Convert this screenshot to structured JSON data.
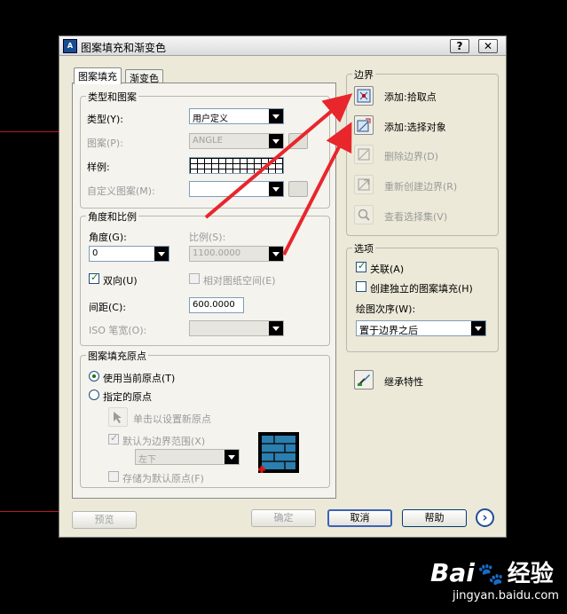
{
  "dialog": {
    "title": "图案填充和渐变色",
    "help_button": "?",
    "close_button": "✕"
  },
  "tabs": [
    {
      "label": "图案填充",
      "selected": true
    },
    {
      "label": "渐变色",
      "selected": false
    }
  ],
  "type_pattern": {
    "title": "类型和图案",
    "type_label": "类型(Y):",
    "type_value": "用户定义",
    "pattern_label": "图案(P):",
    "pattern_value": "ANGLE",
    "sample_label": "样例:",
    "custom_label": "自定义图案(M):",
    "custom_value": ""
  },
  "angle_scale": {
    "title": "角度和比例",
    "angle_label": "角度(G):",
    "angle_value": "0",
    "scale_label": "比例(S):",
    "scale_value": "1100.0000",
    "double_label": "双向(U)",
    "double_checked": true,
    "relative_label": "相对图纸空间(E)",
    "relative_checked": false,
    "spacing_label": "间距(C):",
    "spacing_value": "600.0000",
    "iso_label": "ISO 笔宽(O):",
    "iso_value": ""
  },
  "origin": {
    "title": "图案填充原点",
    "use_current_label": "使用当前原点(T)",
    "use_current_selected": true,
    "specified_label": "指定的原点",
    "specified_selected": false,
    "click_set_label": "单击以设置新原点",
    "default_extent_label": "默认为边界范围(X)",
    "default_extent_checked": true,
    "position_value": "左下",
    "store_default_label": "存储为默认原点(F)",
    "store_default_checked": false
  },
  "boundary": {
    "title": "边界",
    "items": [
      {
        "label": "添加:拾取点",
        "icon": "pick-points-icon",
        "enabled": true
      },
      {
        "label": "添加:选择对象",
        "icon": "select-objects-icon",
        "enabled": true
      },
      {
        "label": "删除边界(D)",
        "icon": "remove-boundary-icon",
        "enabled": false
      },
      {
        "label": "重新创建边界(R)",
        "icon": "recreate-boundary-icon",
        "enabled": false
      },
      {
        "label": "查看选择集(V)",
        "icon": "view-selections-icon",
        "enabled": false
      }
    ]
  },
  "options": {
    "title": "选项",
    "associative_label": "关联(A)",
    "associative_checked": true,
    "separate_label": "创建独立的图案填充(H)",
    "separate_checked": false,
    "draw_order_label": "绘图次序(W):",
    "draw_order_value": "置于边界之后"
  },
  "inherit": {
    "label": "继承特性",
    "icon": "inherit-properties-icon"
  },
  "footer": {
    "preview": "预览",
    "ok": "确定",
    "cancel": "取消",
    "help": "帮助",
    "more": "›"
  },
  "watermark": {
    "brand_left": "Bai",
    "brand_right": "经验",
    "url": "jingyan.baidu.com"
  },
  "colors": {
    "annotation_arrow": "#e8262c",
    "dialog_bg": "#ece9d8",
    "background": "#000000"
  }
}
